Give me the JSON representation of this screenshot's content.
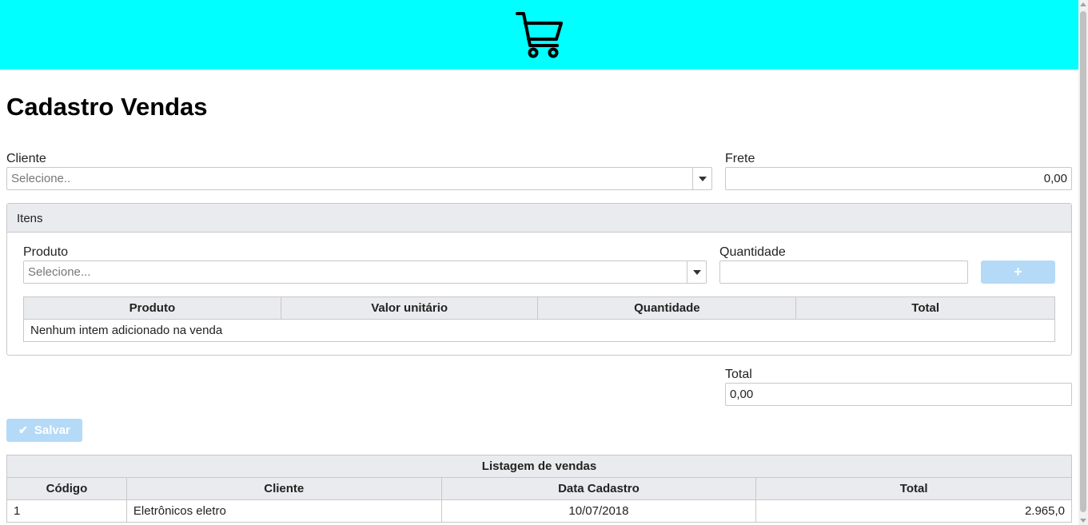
{
  "header": {
    "icon": "shopping-cart-icon",
    "background": "#00ffff"
  },
  "page": {
    "title": "Cadastro Vendas"
  },
  "form": {
    "cliente_label": "Cliente",
    "cliente_placeholder": "Selecione..",
    "frete_label": "Frete",
    "frete_value": "0,00",
    "total_label": "Total",
    "total_value": "0,00",
    "save_label": "Salvar"
  },
  "itens": {
    "panel_title": "Itens",
    "produto_label": "Produto",
    "produto_placeholder": "Selecione...",
    "quantidade_label": "Quantidade",
    "quantidade_value": "",
    "add_label": "+",
    "columns": [
      "Produto",
      "Valor unitário",
      "Quantidade",
      "Total"
    ],
    "empty_message": "Nenhum intem adicionado na venda"
  },
  "listagem": {
    "caption": "Listagem de vendas",
    "columns": [
      "Código",
      "Cliente",
      "Data Cadastro",
      "Total"
    ],
    "rows": [
      {
        "codigo": "1",
        "cliente": "Eletrônicos eletro",
        "data": "10/07/2018",
        "total": "2.965,0"
      }
    ]
  },
  "colors": {
    "accent_disabled": "#b4daf7",
    "header_bg": "#eaebee",
    "border": "#c8c8c8"
  }
}
